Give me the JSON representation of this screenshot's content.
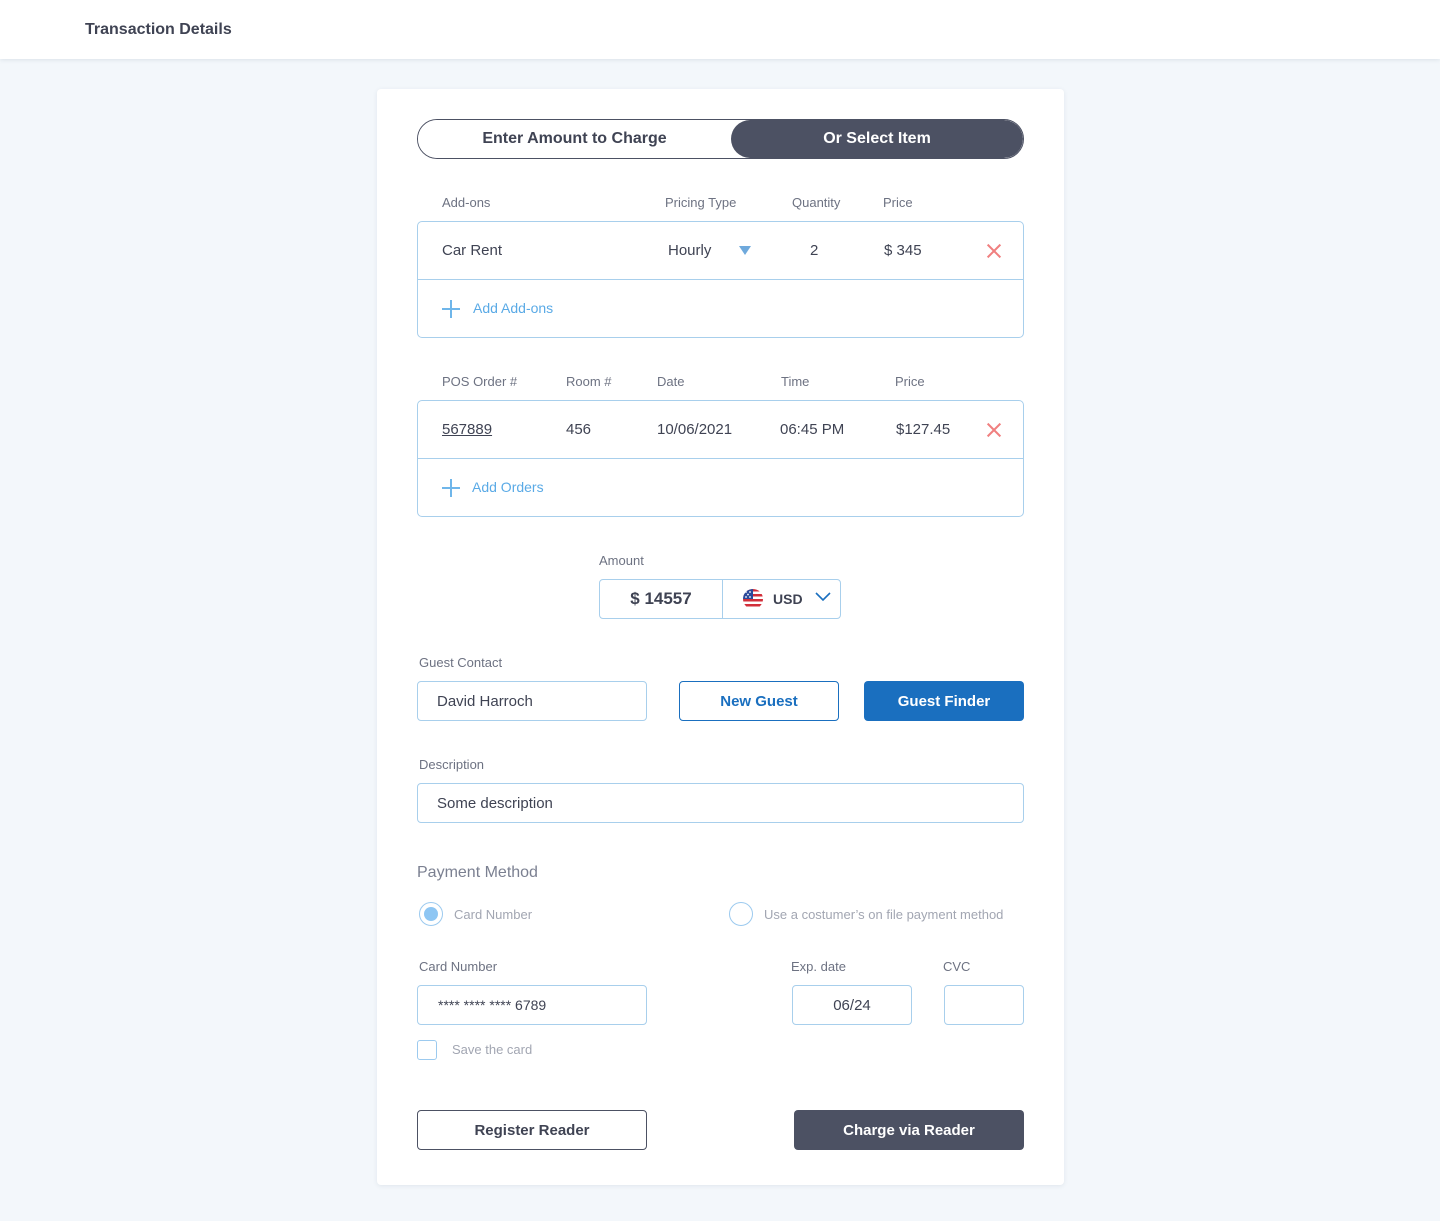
{
  "header": {
    "title": "Transaction Details"
  },
  "mode_toggle": {
    "left_label": "Enter Amount to Charge",
    "right_label": "Or Select Item",
    "active": "right"
  },
  "addons": {
    "columns": {
      "name": "Add-ons",
      "pricing_type": "Pricing Type",
      "quantity": "Quantity",
      "price": "Price"
    },
    "rows": [
      {
        "name": "Car Rent",
        "pricing_type": "Hourly",
        "quantity": "2",
        "price": "$ 345"
      }
    ],
    "add_label": "Add Add-ons"
  },
  "orders": {
    "columns": {
      "order": "POS Order #",
      "room": "Room #",
      "date": "Date",
      "time": "Time",
      "price": "Price"
    },
    "rows": [
      {
        "order": "567889",
        "room": "456",
        "date": "10/06/2021",
        "time": "06:45 PM",
        "price": "$127.45"
      }
    ],
    "add_label": "Add Orders"
  },
  "amount": {
    "label": "Amount",
    "value": "$ 14557",
    "currency": "USD"
  },
  "guest": {
    "label": "Guest Contact",
    "value": "David Harroch",
    "new_guest_label": "New Guest",
    "finder_label": "Guest Finder"
  },
  "description": {
    "label": "Description",
    "value": "Some description"
  },
  "payment": {
    "title": "Payment Method",
    "option_card": "Card Number",
    "option_file": "Use a costumer’s on file payment method",
    "selected": "card",
    "card_label": "Card Number",
    "card_value": "**** **** **** 6789",
    "exp_label": "Exp. date",
    "exp_value": "06/24",
    "cvc_label": "CVC",
    "cvc_value": "",
    "save_label": "Save the card",
    "save_checked": false
  },
  "actions": {
    "register_label": "Register Reader",
    "charge_label": "Charge via Reader"
  },
  "colors": {
    "accent": "#1a6fbf",
    "dark": "#4c5163",
    "border": "#a8cfec",
    "danger": "#f07f7f"
  }
}
